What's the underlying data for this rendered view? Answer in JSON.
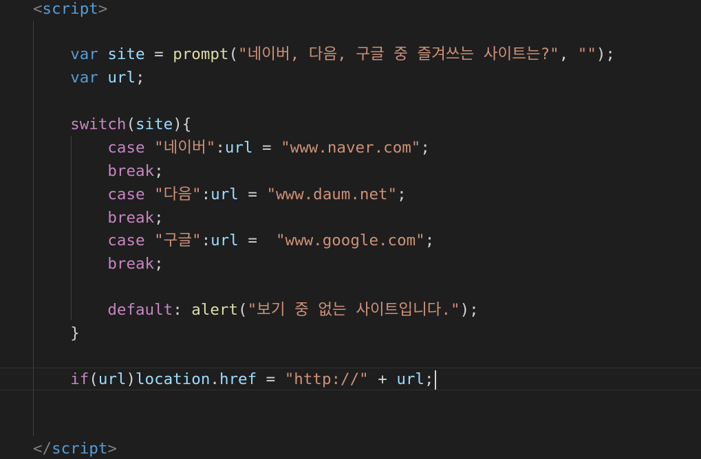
{
  "editor": {
    "theme": {
      "background": "#1e1e1e",
      "keyword": "#569cd6",
      "control": "#c586c0",
      "variable": "#9cdcfe",
      "function": "#dcdcaa",
      "string": "#ce9178",
      "text": "#d4d4d4"
    },
    "code": {
      "open_tag": "script",
      "close_tag": "script",
      "l1": {
        "kw": "var",
        "name": "site",
        "fn": "prompt",
        "str1": "\"네이버, 다음, 구글 중 즐겨쓰는 사이트는?\"",
        "str2": "\"\""
      },
      "l2": {
        "kw": "var",
        "name": "url"
      },
      "l3": {
        "kw": "switch",
        "arg": "site"
      },
      "cases": [
        {
          "kw": "case",
          "label": "\"네이버\"",
          "var": "url",
          "value": "\"www.naver.com\"",
          "brk": "break"
        },
        {
          "kw": "case",
          "label": "\"다음\"",
          "var": "url",
          "value": "\"www.daum.net\"",
          "brk": "break"
        },
        {
          "kw": "case",
          "label": "\"구글\"",
          "var": "url",
          "value": "\"www.google.com\"",
          "brk": "break"
        }
      ],
      "def": {
        "kw": "default",
        "fn": "alert",
        "str": "\"보기 중 없는 사이트입니다.\""
      },
      "last": {
        "kw": "if",
        "arg": "url",
        "obj": "location",
        "prop": "href",
        "str": "\"http://\"",
        "var": "url"
      }
    }
  }
}
